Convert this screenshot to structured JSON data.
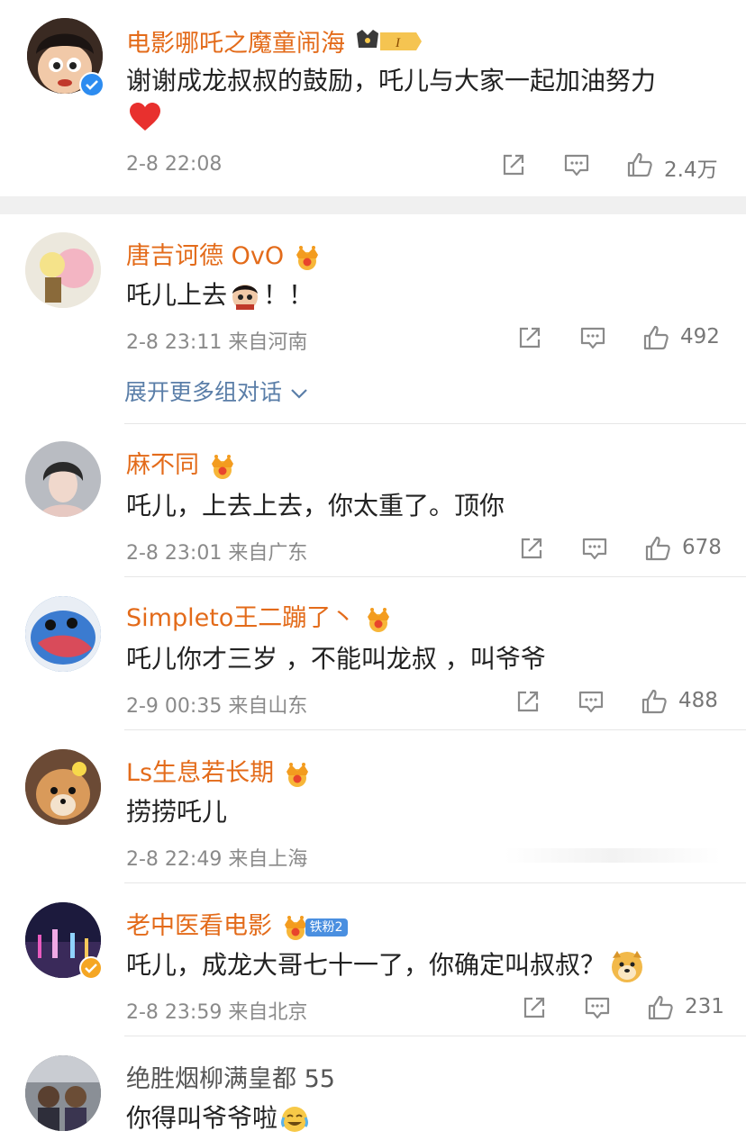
{
  "top_comment": {
    "username": "电影哪吒之魔童闹海",
    "text": "谢谢成龙叔叔的鼓励，吒儿与大家一起加油努力",
    "emoji": "heart-emoji",
    "time": "2-8 22:08",
    "like_count": "2.4万"
  },
  "replies": [
    {
      "username": "唐吉诃德 OvO",
      "text": "吒儿上去",
      "text_suffix": "！！",
      "time": "2-8 23:11",
      "location": "来自河南",
      "like_count": "492"
    },
    {
      "username": "麻不同",
      "text": "吒儿，上去上去，你太重了。顶你",
      "time": "2-8 23:01",
      "location": "来自广东",
      "like_count": "678"
    },
    {
      "username": "Simpleto王二蹦了丶",
      "text": "吒儿你才三岁 ，不能叫龙叔 ，叫爷爷",
      "time": "2-9 00:35",
      "location": "来自山东",
      "like_count": "488"
    },
    {
      "username": "Ls生息若长期",
      "text": "捞捞吒儿",
      "time": "2-8 22:49",
      "location": "来自上海",
      "like_count": ""
    },
    {
      "username": "老中医看电影",
      "badge": "铁粉2",
      "text": "吒儿，成龙大哥七十一了，你确定叫叔叔？",
      "time": "2-8 23:59",
      "location": "来自北京",
      "like_count": "231"
    },
    {
      "username": "绝胜烟柳满皇都 55",
      "text": "你得叫爷爷啦",
      "time": "",
      "location": "",
      "like_count": ""
    }
  ],
  "expand_link": "展开更多组对话",
  "colors": {
    "username": "#e36b1a",
    "link": "#5a7ea8",
    "meta": "#8a8a8a",
    "divider": "#e6e6e6"
  }
}
